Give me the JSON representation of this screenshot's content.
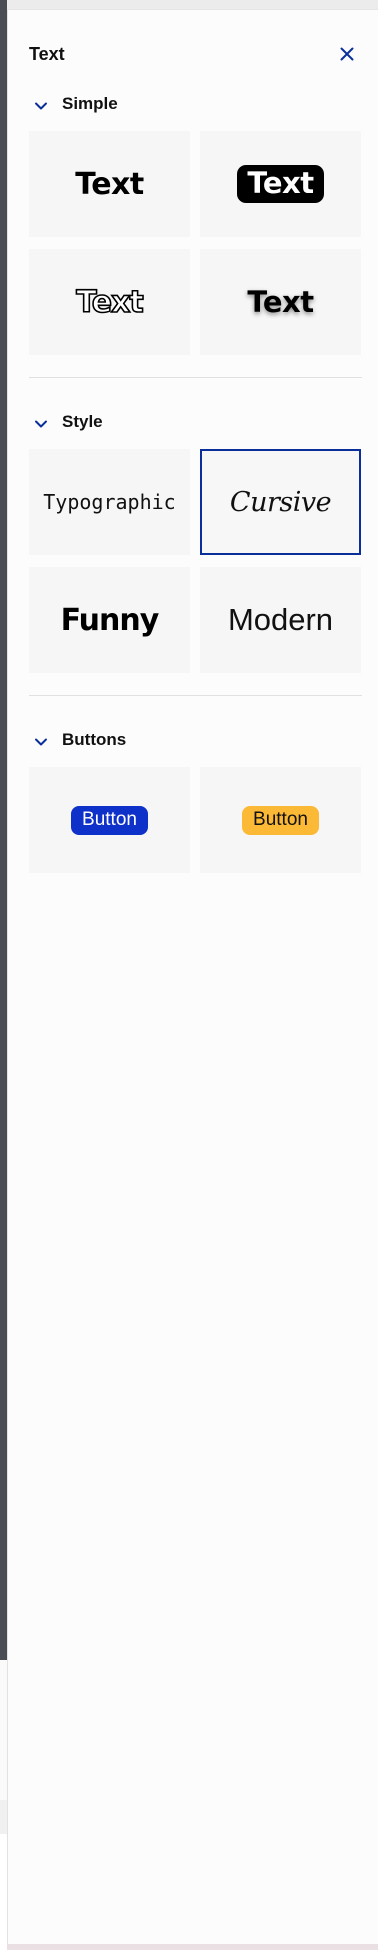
{
  "panel": {
    "title": "Text"
  },
  "icons": {
    "close": "close-icon",
    "collapse": "chevron-down-icon"
  },
  "colors": {
    "accent": "#0b2f9a",
    "button_blue": "#0e31c9",
    "button_yellow": "#fcb936"
  },
  "sections": {
    "simple": {
      "label": "Simple",
      "tiles": [
        "Text",
        "Text",
        "Text",
        "Text"
      ]
    },
    "style": {
      "label": "Style",
      "tiles": [
        "Typographic",
        "Cursive",
        "Funny",
        "Modern"
      ],
      "selected": "Cursive"
    },
    "buttons": {
      "label": "Buttons",
      "tiles": [
        "Button",
        "Button"
      ]
    }
  }
}
